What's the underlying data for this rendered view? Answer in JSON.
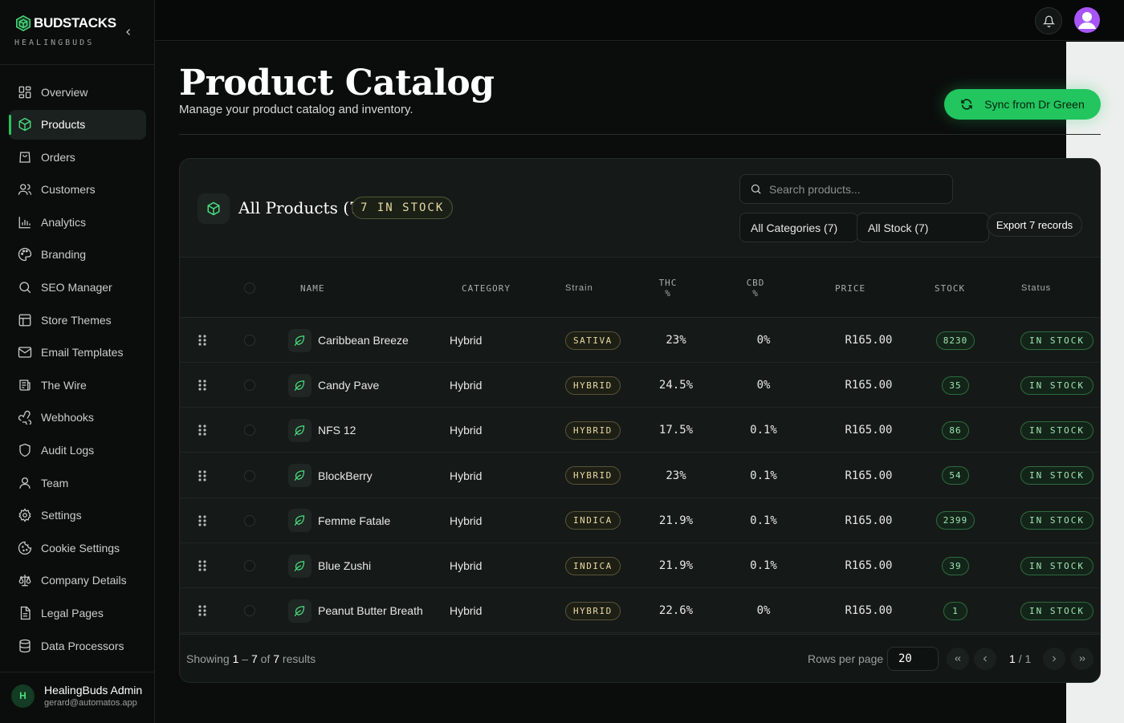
{
  "brand": {
    "name": "BUDSTACKS",
    "sub": "HEALINGBUDS"
  },
  "sidebar": {
    "items": [
      {
        "label": "Overview",
        "icon": "grid-icon"
      },
      {
        "label": "Products",
        "icon": "box-icon",
        "active": true
      },
      {
        "label": "Orders",
        "icon": "shopping-bag-icon"
      },
      {
        "label": "Customers",
        "icon": "users-icon"
      },
      {
        "label": "Analytics",
        "icon": "bar-chart-icon"
      },
      {
        "label": "Branding",
        "icon": "palette-icon"
      },
      {
        "label": "SEO Manager",
        "icon": "search-icon"
      },
      {
        "label": "Store Themes",
        "icon": "layout-icon"
      },
      {
        "label": "Email Templates",
        "icon": "mail-icon"
      },
      {
        "label": "The Wire",
        "icon": "newspaper-icon"
      },
      {
        "label": "Webhooks",
        "icon": "webhook-icon"
      },
      {
        "label": "Audit Logs",
        "icon": "shield-icon"
      },
      {
        "label": "Team",
        "icon": "user-icon"
      },
      {
        "label": "Settings",
        "icon": "gear-icon"
      },
      {
        "label": "Cookie Settings",
        "icon": "cookie-icon"
      },
      {
        "label": "Company Details",
        "icon": "scale-icon"
      },
      {
        "label": "Legal Pages",
        "icon": "file-text-icon"
      },
      {
        "label": "Data Processors",
        "icon": "database-icon"
      }
    ]
  },
  "user": {
    "initial": "H",
    "name": "HealingBuds Admin",
    "email": "gerard@automatos.app"
  },
  "header": {
    "title": "Product Catalog",
    "subtitle": "Manage your product catalog and inventory.",
    "sync_label": "Sync from Dr Green"
  },
  "card": {
    "title": "All Products (7)",
    "stock_pill": "7 IN STOCK",
    "search_placeholder": "Search products...",
    "filter_categories": "All Categories (7)",
    "filter_stock": "All Stock (7)",
    "export_label": "Export 7 records"
  },
  "table": {
    "headers": {
      "name": "NAME",
      "category": "CATEGORY",
      "strain": "Strain",
      "thc": "THC\n%",
      "cbd": "CBD\n%",
      "price": "PRICE",
      "stock": "STOCK",
      "status": "Status"
    },
    "rows": [
      {
        "name": "Caribbean Breeze",
        "category": "Hybrid",
        "strain": "SATIVA",
        "thc": "23%",
        "cbd": "0%",
        "price": "R165.00",
        "stock": "8230",
        "status": "IN STOCK"
      },
      {
        "name": "Candy Pave",
        "category": "Hybrid",
        "strain": "HYBRID",
        "thc": "24.5%",
        "cbd": "0%",
        "price": "R165.00",
        "stock": "35",
        "status": "IN STOCK"
      },
      {
        "name": "NFS 12",
        "category": "Hybrid",
        "strain": "HYBRID",
        "thc": "17.5%",
        "cbd": "0.1%",
        "price": "R165.00",
        "stock": "86",
        "status": "IN STOCK"
      },
      {
        "name": "BlockBerry",
        "category": "Hybrid",
        "strain": "HYBRID",
        "thc": "23%",
        "cbd": "0.1%",
        "price": "R165.00",
        "stock": "54",
        "status": "IN STOCK"
      },
      {
        "name": "Femme Fatale",
        "category": "Hybrid",
        "strain": "INDICA",
        "thc": "21.9%",
        "cbd": "0.1%",
        "price": "R165.00",
        "stock": "2399",
        "status": "IN STOCK"
      },
      {
        "name": "Blue Zushi",
        "category": "Hybrid",
        "strain": "INDICA",
        "thc": "21.9%",
        "cbd": "0.1%",
        "price": "R165.00",
        "stock": "39",
        "status": "IN STOCK"
      },
      {
        "name": "Peanut Butter Breath",
        "category": "Hybrid",
        "strain": "HYBRID",
        "thc": "22.6%",
        "cbd": "0%",
        "price": "R165.00",
        "stock": "1",
        "status": "IN STOCK"
      }
    ]
  },
  "footer": {
    "showing_prefix": "Showing",
    "range_start": "1",
    "range_sep": "–",
    "range_end": "7",
    "of": "of",
    "total": "7",
    "results": "results",
    "rows_per_page_label": "Rows per page",
    "rows_per_page": "20",
    "page_current": "1",
    "page_total": "/ 1"
  },
  "colors": {
    "accent": "#22c55e",
    "avatar": "#a855f7"
  }
}
